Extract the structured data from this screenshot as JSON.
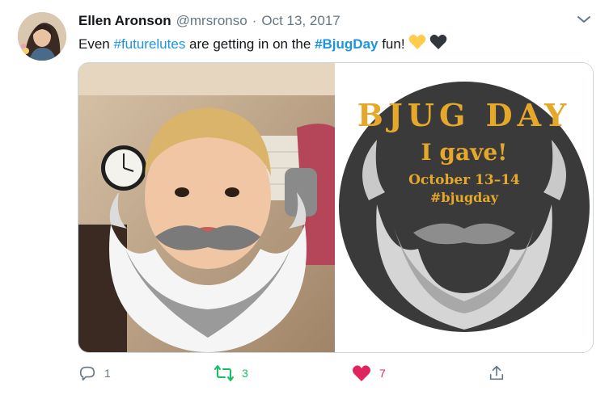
{
  "tweet": {
    "author_name": "Ellen Aronson",
    "handle": "@mrsronso",
    "separator": "·",
    "date": "Oct 13, 2017",
    "text": {
      "part1": "Even ",
      "hashtag1": "#futurelutes",
      "part2": " are getting in on the ",
      "hashtag2": "#BjugDay",
      "part3": " fun!"
    },
    "emojis": [
      "yellow-heart",
      "black-heart"
    ]
  },
  "media": {
    "right_badge": {
      "arc_text": "BJUG DAY",
      "line1": "I gave!",
      "line2": "October 13–14",
      "line3": "#bjugday"
    }
  },
  "actions": {
    "reply_count": "1",
    "retweet_count": "3",
    "like_count": "7"
  },
  "colors": {
    "link": "#1b95e0",
    "retweet": "#17bf63",
    "like": "#e0245e",
    "muted": "#657786",
    "badge_gold": "#e6a82a",
    "badge_dark": "#3a3a3a"
  }
}
